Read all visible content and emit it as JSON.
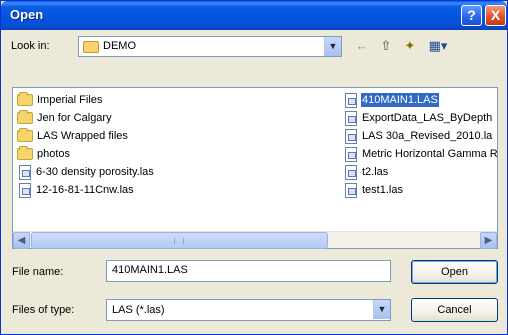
{
  "window": {
    "title": "Open",
    "help_glyph": "?",
    "close_glyph": "X"
  },
  "toolbar": {
    "lookin_label": "Look in:",
    "lookin_value": "DEMO",
    "icons": [
      "back-arrow-icon",
      "up-folder-icon",
      "new-folder-icon",
      "views-menu-icon"
    ]
  },
  "files": {
    "col1": [
      {
        "type": "folder",
        "name": "Imperial Files"
      },
      {
        "type": "folder",
        "name": "Jen for Calgary"
      },
      {
        "type": "folder",
        "name": "LAS Wrapped files"
      },
      {
        "type": "folder",
        "name": "photos"
      },
      {
        "type": "file",
        "name": "6-30 density porosity.las"
      },
      {
        "type": "file",
        "name": "12-16-81-11Cnw.las"
      }
    ],
    "col2": [
      {
        "type": "file",
        "name": "410MAIN1.LAS",
        "selected": true
      },
      {
        "type": "file",
        "name": "ExportData_LAS_ByDepth"
      },
      {
        "type": "file",
        "name": "LAS 30a_Revised_2010.la"
      },
      {
        "type": "file",
        "name": "Metric Horizontal Gamma R"
      },
      {
        "type": "file",
        "name": "t2.las"
      },
      {
        "type": "file",
        "name": "test1.las"
      }
    ],
    "scroll_position": 0.0
  },
  "form": {
    "filename_label": "File name:",
    "filename_value": "410MAIN1.LAS",
    "filetype_label": "Files of type:",
    "filetype_value": "LAS (*.las)",
    "open_label": "Open",
    "cancel_label": "Cancel"
  },
  "colors": {
    "titlebar": "#0454e0",
    "selection": "#316ac5",
    "dialog_bg": "#ece9d8"
  }
}
